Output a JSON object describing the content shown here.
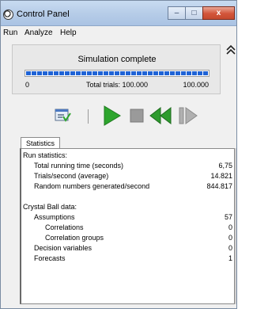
{
  "window": {
    "title": "Control Panel",
    "buttons": {
      "minimize": "–",
      "maximize": "□",
      "close": "x"
    }
  },
  "menu": [
    "Run",
    "Analyze",
    "Help"
  ],
  "progress": {
    "status": "Simulation complete",
    "min_label": "0",
    "total_label": "Total trials: 100.000",
    "max_label": "100.000",
    "fraction": 1.0
  },
  "toolbar": {
    "icons": [
      "run-preferences-icon",
      "run-icon",
      "stop-icon",
      "reset-icon",
      "single-step-icon"
    ],
    "colors": {
      "run": "#2da52d",
      "stop": "#9a9a9a",
      "reset": "#2e9b2e",
      "step": "#9a9a9a"
    }
  },
  "tabs": {
    "statistics": "Statistics"
  },
  "stats": [
    {
      "label": "Run statistics:",
      "value": "",
      "indent": 0
    },
    {
      "label": "Total running time (seconds)",
      "value": "6,75",
      "indent": 1
    },
    {
      "label": "Trials/second (average)",
      "value": "14.821",
      "indent": 1
    },
    {
      "label": "Random numbers generated/second",
      "value": "844.817",
      "indent": 1
    },
    {
      "label": "",
      "value": "",
      "indent": 0
    },
    {
      "label": "Crystal Ball data:",
      "value": "",
      "indent": 0
    },
    {
      "label": "Assumptions",
      "value": "57",
      "indent": 1
    },
    {
      "label": "Correlations",
      "value": "0",
      "indent": 2
    },
    {
      "label": "Correlation groups",
      "value": "0",
      "indent": 2
    },
    {
      "label": "Decision variables",
      "value": "0",
      "indent": 1
    },
    {
      "label": "Forecasts",
      "value": "1",
      "indent": 1
    }
  ]
}
